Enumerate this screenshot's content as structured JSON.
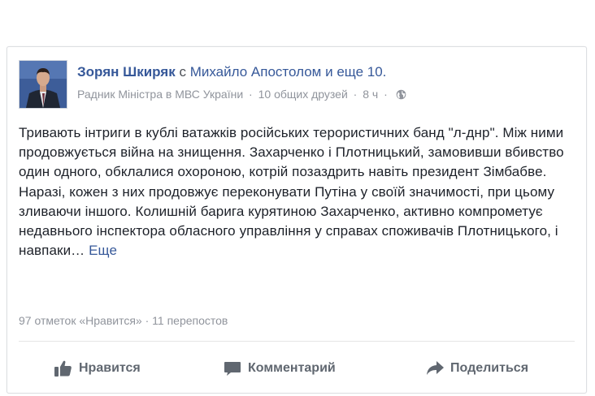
{
  "post": {
    "author": "Зорян Шкиряк",
    "with_prefix": "с",
    "tagged": "Михайло Апостолом",
    "and_more": "и еще 10.",
    "role": "Радник Міністра в МВС України",
    "mutual_friends": "10 общих друзей",
    "time": "8 ч",
    "separator": "·",
    "privacy_icon": "globe-icon",
    "text": "Тривають інтриги в кублі ватажків російських терористичних банд \"л-днр\". Між ними продовжується війна на знищення. Захарченко і Плотницький, замовивши вбивство один одного, обклалися охороною, котрій позаздрить навіть президент Зімбабве. Наразі, кожен з них продовжує переконувати Путіна у своїй значимості, при цьому зливаючи іншого. Колишній барига курятиною Захарченко, активно компрометує недавнього інспектора обласного управління у справах споживачів Плотницького, і навпаки…",
    "see_more": "Еще"
  },
  "stats": {
    "likes": "97 отметок «Нравится»",
    "separator": "·",
    "shares": "11 перепостов"
  },
  "actions": {
    "like": "Нравится",
    "comment": "Комментарий",
    "share": "Поделиться"
  },
  "colors": {
    "link": "#365899",
    "text": "#1d2129",
    "meta": "#90949c",
    "action": "#606770",
    "border": "#dddfe2"
  }
}
